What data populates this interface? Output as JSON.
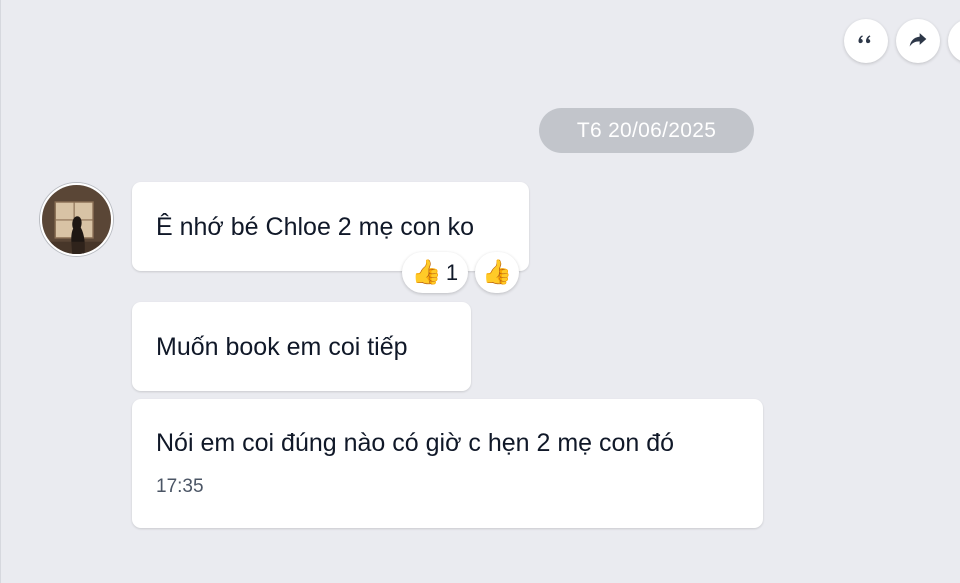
{
  "toolbar": {
    "quote_icon": "quote-icon",
    "forward_icon": "forward-icon"
  },
  "date_separator": "T6 20/06/2025",
  "messages": [
    {
      "text": "Ê nhớ bé Chloe 2 mẹ con ko"
    },
    {
      "text": "Muốn book em coi tiếp"
    },
    {
      "text": "Nói em coi đúng nào có giờ c hẹn 2 mẹ con đó",
      "time": "17:35"
    }
  ],
  "reactions": {
    "emoji": "👍",
    "count": "1"
  },
  "colors": {
    "background": "#eaebf0",
    "bubble": "#ffffff",
    "date_pill": "#c2c5cb",
    "text": "#101828"
  }
}
